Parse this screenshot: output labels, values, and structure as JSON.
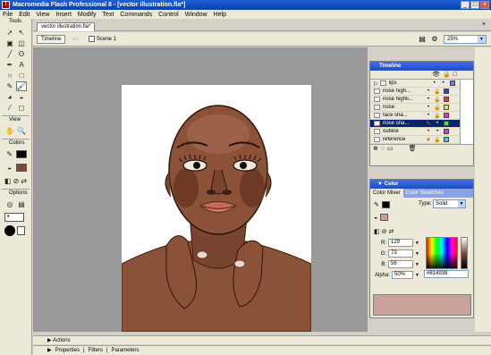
{
  "window": {
    "title": "Macromedia Flash Professional 8 - [vector illustration.fla*]",
    "app_icon": "f"
  },
  "menu": [
    "File",
    "Edit",
    "View",
    "Insert",
    "Modify",
    "Text",
    "Commands",
    "Control",
    "Window",
    "Help"
  ],
  "tools": {
    "header": "Tools",
    "view_label": "View",
    "colors_label": "Colors",
    "options_label": "Options",
    "icons": [
      "arrow-icon",
      "subselect-icon",
      "free-transform-icon",
      "fill-transform-icon",
      "line-icon",
      "lasso-icon",
      "pen-icon",
      "text-icon",
      "oval-icon",
      "rectangle-icon",
      "pencil-icon",
      "brush-icon",
      "ink-bottle-icon",
      "paint-bucket-icon",
      "eyedropper-icon",
      "eraser-icon"
    ]
  },
  "document": {
    "tab_label": "vector illustration.fla*",
    "timeline_button": "Timeline",
    "scene_label": "Scene 1",
    "zoom": "25%"
  },
  "timeline": {
    "header": "Timeline",
    "layers": [
      {
        "name": "lips",
        "color": "#7b6fe0",
        "selected": false,
        "folder": true
      },
      {
        "name": "nose high...",
        "color": "#3a3ad0",
        "selected": false
      },
      {
        "name": "nose highli...",
        "color": "#e03a3a",
        "selected": false
      },
      {
        "name": "nose",
        "color": "#e0e04a",
        "selected": false
      },
      {
        "name": "face sha...",
        "color": "#e03ae0",
        "selected": false
      },
      {
        "name": "nose sha...",
        "color": "#4ae04a",
        "selected": true
      },
      {
        "name": "outline",
        "color": "#b04ae0",
        "selected": false
      },
      {
        "name": "reference",
        "color": "#3ad0d0",
        "selected": false
      }
    ]
  },
  "color": {
    "header": "Color",
    "tab_mixer": "Color Mixer",
    "tab_swatches": "Color Swatches",
    "type_label": "Type:",
    "type_value": "Solid",
    "r_label": "R:",
    "r": "129",
    "g_label": "G:",
    "g": "73",
    "b_label": "B:",
    "b": "56",
    "alpha_label": "Alpha:",
    "alpha": "50%",
    "hex": "#814938"
  },
  "panels": {
    "actions": "Actions",
    "properties": "Properties",
    "filters": "Filters",
    "parameters": "Parameters"
  }
}
